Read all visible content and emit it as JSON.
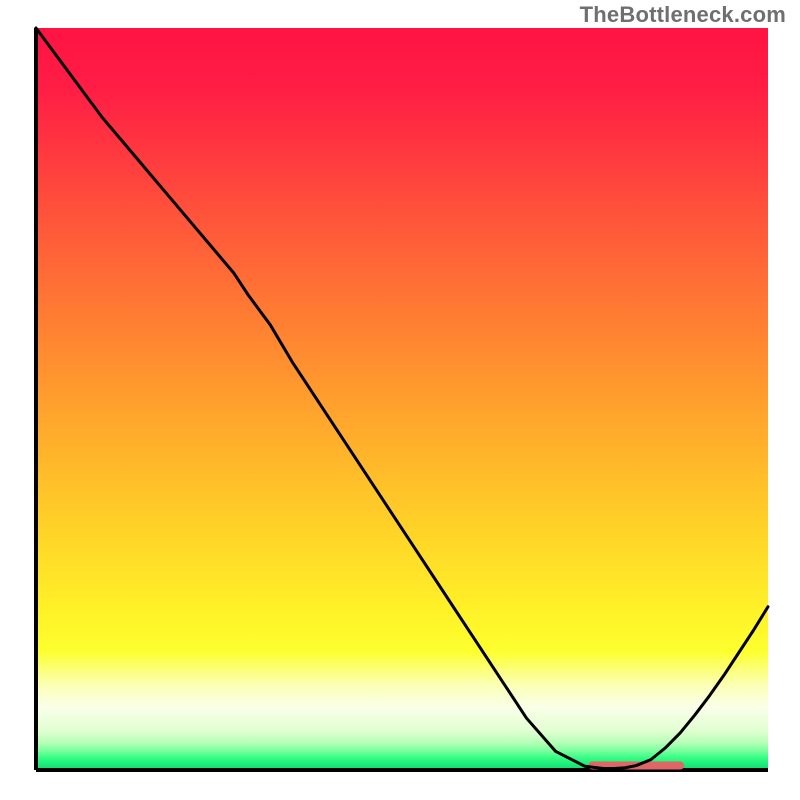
{
  "attribution": "TheBottleneck.com",
  "chart_data": {
    "type": "line",
    "title": "",
    "xlabel": "",
    "ylabel": "",
    "xlim": [
      0,
      100
    ],
    "ylim": [
      0,
      100
    ],
    "grid": false,
    "series": [
      {
        "name": "curve",
        "x": [
          0,
          3,
          6,
          9,
          12,
          15,
          18,
          21,
          24,
          27,
          29,
          32,
          35,
          39,
          43,
          47,
          51,
          55,
          59,
          63,
          67,
          71,
          75,
          77.5,
          79,
          80.5,
          82,
          84,
          86,
          88,
          90,
          92,
          94,
          96,
          98,
          100
        ],
        "values": [
          100,
          96,
          92,
          88,
          84.5,
          81,
          77.5,
          74,
          70.5,
          67,
          64,
          60,
          55,
          49,
          43,
          37,
          31,
          25,
          19,
          13,
          7,
          2.5,
          0.5,
          0.2,
          0.2,
          0.3,
          0.6,
          1.4,
          3.0,
          5.0,
          7.4,
          10.0,
          12.8,
          15.8,
          18.8,
          22
        ]
      }
    ],
    "annotations": [
      {
        "name": "valley-marker",
        "x_start": 76,
        "x_end": 88,
        "y": 0.6,
        "color": "#e06666"
      }
    ],
    "colors": {
      "line": "#000000",
      "axis": "#000000",
      "marker": "#e06666",
      "gradient": [
        {
          "stop": 0.0,
          "color": "#ff1344"
        },
        {
          "stop": 0.08,
          "color": "#ff1d45"
        },
        {
          "stop": 0.18,
          "color": "#ff3c3f"
        },
        {
          "stop": 0.28,
          "color": "#ff5c39"
        },
        {
          "stop": 0.38,
          "color": "#ff7a33"
        },
        {
          "stop": 0.48,
          "color": "#ff982e"
        },
        {
          "stop": 0.58,
          "color": "#ffb62a"
        },
        {
          "stop": 0.68,
          "color": "#ffd428"
        },
        {
          "stop": 0.78,
          "color": "#fff028"
        },
        {
          "stop": 0.84,
          "color": "#fdff2e"
        },
        {
          "stop": 0.885,
          "color": "#fbffb4"
        },
        {
          "stop": 0.915,
          "color": "#faffe8"
        },
        {
          "stop": 0.946,
          "color": "#e3ffd3"
        },
        {
          "stop": 0.963,
          "color": "#b6ffb7"
        },
        {
          "stop": 0.974,
          "color": "#7aff9f"
        },
        {
          "stop": 0.982,
          "color": "#3fff88"
        },
        {
          "stop": 0.991,
          "color": "#1cf07a"
        },
        {
          "stop": 1.0,
          "color": "#15d66f"
        }
      ]
    }
  }
}
